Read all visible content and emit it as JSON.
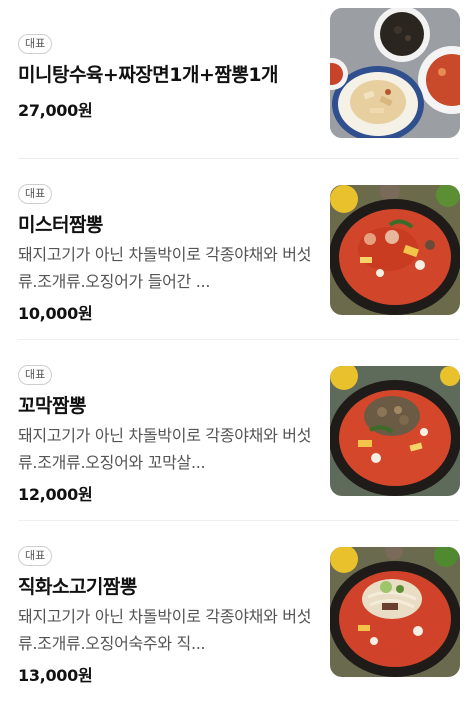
{
  "menu": {
    "items": [
      {
        "badge": "대표",
        "name": "미니탕수육+짜장면1개+짬뽕1개",
        "description": "",
        "price": "27,000원",
        "image_icon": "food-photo-sweet-sour-pork-set"
      },
      {
        "badge": "대표",
        "name": "미스터짬뽕",
        "description": "돼지고기가 아닌 차돌박이로 각종야채와 버섯류.조개류.오징어가 들어간 ...",
        "price": "10,000원",
        "image_icon": "food-photo-jjamppong"
      },
      {
        "badge": "대표",
        "name": "꼬막짬뽕",
        "description": "돼지고기가 아닌 차돌박이로 각종야채와 버섯류.조개류.오징어와 꼬막살...",
        "price": "12,000원",
        "image_icon": "food-photo-cockle-jjamppong"
      },
      {
        "badge": "대표",
        "name": "직화소고기짬뽕",
        "description": "돼지고기가 아닌 차돌박이로 각종야채와 버섯류.조개류.오징어숙주와 직...",
        "price": "13,000원",
        "image_icon": "food-photo-beef-jjamppong"
      }
    ]
  }
}
